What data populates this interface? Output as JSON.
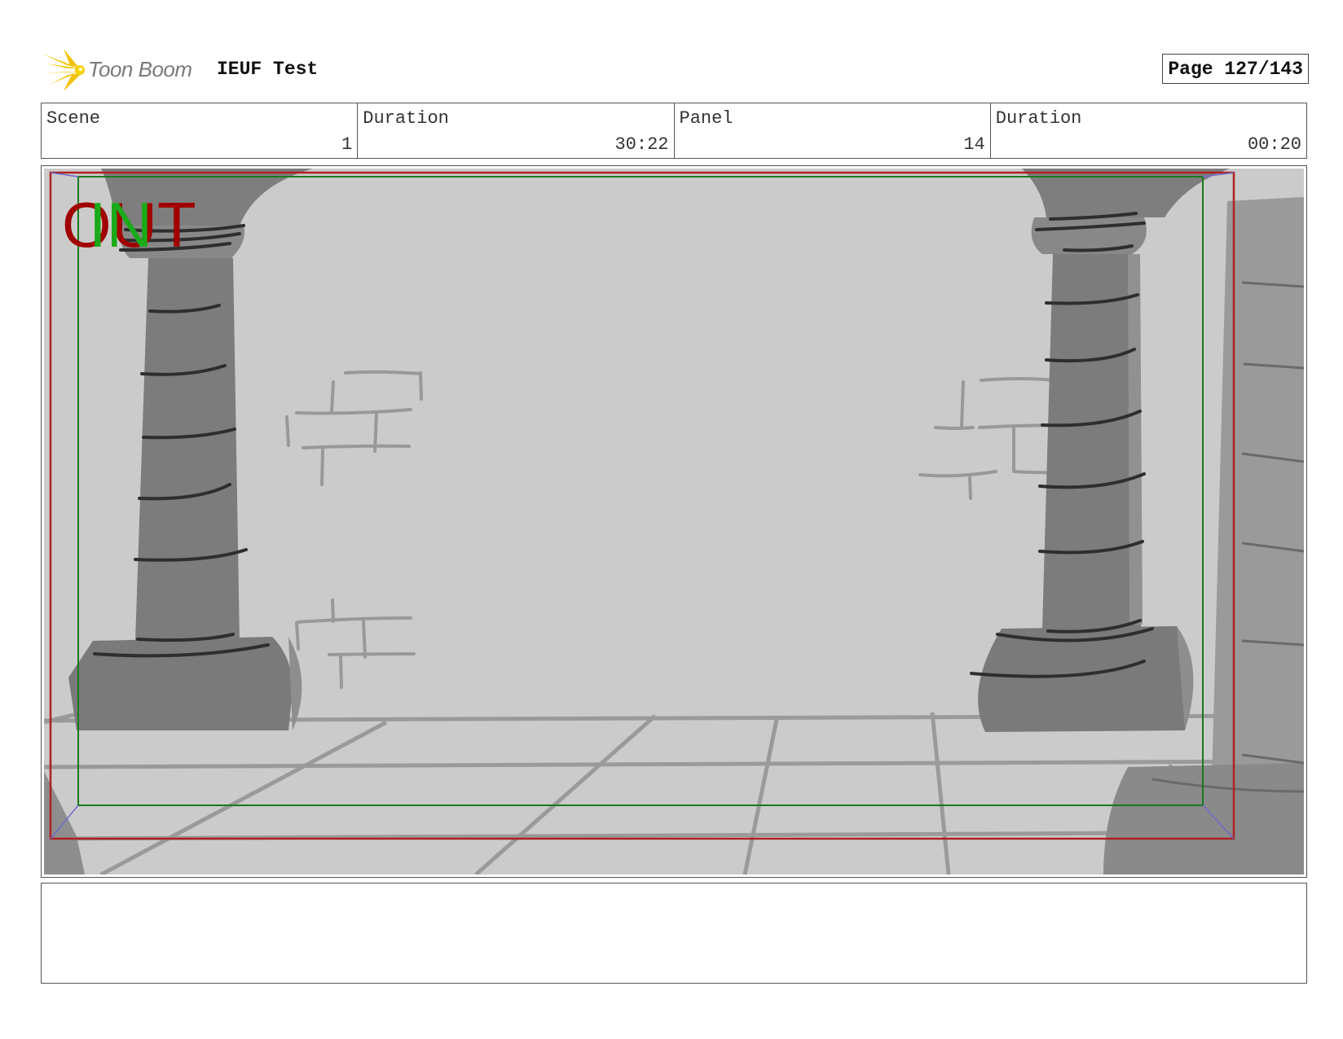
{
  "header": {
    "logo_text": "Toon Boom",
    "project_title": "IEUF Test",
    "page_label": "Page 127/143"
  },
  "info": {
    "scene_label": "Scene",
    "scene_value": "1",
    "scene_duration_label": "Duration",
    "scene_duration_value": "30:22",
    "panel_label": "Panel",
    "panel_value": "14",
    "panel_duration_label": "Duration",
    "panel_duration_value": "00:20"
  },
  "panel": {
    "out_marker": "OUT",
    "in_marker": "IN"
  },
  "colors": {
    "background_gray": "#cccccc",
    "pillar_gray": "#808080",
    "safe_frame_red": "#b02020",
    "safe_frame_green": "#1a7a1a",
    "out_text": "#a00000",
    "in_text": "#1aaa1a"
  }
}
